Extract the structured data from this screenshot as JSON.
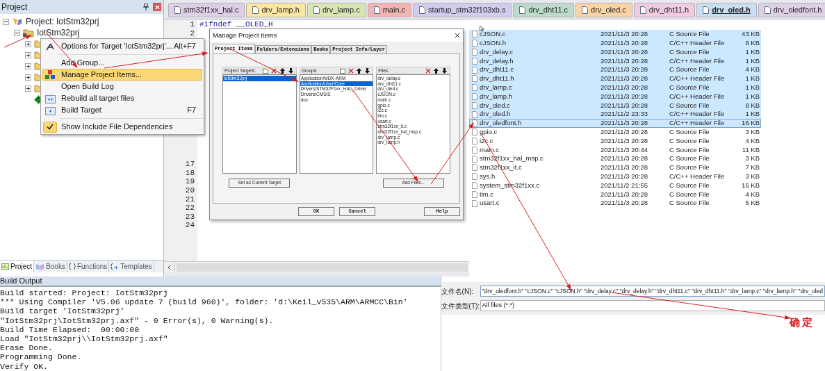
{
  "project_panel": {
    "title": "Project",
    "tree": [
      {
        "label": "Project: IotStm32prj",
        "kind": "project",
        "expanded": true,
        "children": [
          {
            "label": "IotStm32prj",
            "kind": "target",
            "expanded": true,
            "children": [
              {
                "kind": "folder",
                "expanded": false
              },
              {
                "kind": "folder",
                "expanded": false
              },
              {
                "kind": "folder",
                "expanded": false
              },
              {
                "kind": "folder",
                "expanded": false
              },
              {
                "kind": "folder",
                "expanded": false
              },
              {
                "kind": "component"
              }
            ]
          }
        ]
      }
    ],
    "bottom_tabs": [
      {
        "label": "Project",
        "selected": true
      },
      {
        "label": "Books",
        "selected": false
      },
      {
        "label": "Functions",
        "selected": false
      },
      {
        "label": "Templates",
        "selected": false
      }
    ]
  },
  "context_menu": {
    "items": [
      {
        "kind": "item",
        "label": "Options for Target 'IotStm32prj'...",
        "shortcut": "Alt+F7",
        "selected": false
      },
      {
        "kind": "separator"
      },
      {
        "kind": "item",
        "label": "Add Group...",
        "selected": false
      },
      {
        "kind": "item",
        "label": "Manage Project Items...",
        "selected": true
      },
      {
        "kind": "item",
        "label": "Open Build Log",
        "selected": false
      },
      {
        "kind": "item",
        "label": "Rebuild all target files",
        "selected": false
      },
      {
        "kind": "item",
        "label": "Build Target",
        "shortcut": "F7",
        "selected": false
      },
      {
        "kind": "separator"
      },
      {
        "kind": "check",
        "label": "Show Include File Dependencies",
        "checked": true,
        "selected": false
      }
    ]
  },
  "editor_tabs": [
    {
      "label": "stm32f1xx_hal.c",
      "color": "#dccfe6",
      "selected": false
    },
    {
      "label": "drv_lamp.h",
      "color": "#fbe7a1",
      "selected": false
    },
    {
      "label": "drv_lamp.c",
      "color": "#d9e6b4",
      "selected": false
    },
    {
      "label": "main.c",
      "color": "#f2b3b3",
      "selected": false
    },
    {
      "label": "startup_stm32f103xb.s",
      "color": "#d3ccef",
      "selected": false
    },
    {
      "label": "drv_dht11.c",
      "color": "#bcdcc9",
      "selected": false
    },
    {
      "label": "drv_oled.c",
      "color": "#fad3a6",
      "selected": false
    },
    {
      "label": "drv_dht11.h",
      "color": "#f1cbe0",
      "selected": false
    },
    {
      "label": "drv_oled.h",
      "color": "#c9def1",
      "selected": true
    },
    {
      "label": "drv_oledfont.h",
      "color": "#ddd1e6",
      "selected": false
    }
  ],
  "editor": {
    "lines": [
      {
        "number": "1",
        "code": "#ifndef __OLED_H"
      },
      {
        "number": "2"
      },
      {
        "number": "17"
      },
      {
        "number": "18"
      },
      {
        "number": "19"
      },
      {
        "number": "20"
      },
      {
        "number": "21"
      },
      {
        "number": "22"
      },
      {
        "number": "23"
      },
      {
        "number": "24"
      }
    ]
  },
  "dialog": {
    "title": "Manage Project Items",
    "tabs": [
      {
        "label": "Project Items",
        "selected": true
      },
      {
        "label": "Folders/Extensions",
        "selected": false
      },
      {
        "label": "Books",
        "selected": false
      },
      {
        "label": "Project Info/Layer",
        "selected": false
      }
    ],
    "panes": [
      {
        "label": "Project Targets:",
        "new": true,
        "items": [
          {
            "label": "IotStm32prj",
            "selected": true
          }
        ],
        "button": "Set as Current Target"
      },
      {
        "label": "Groups:",
        "new": true,
        "items": [
          {
            "label": "Application/MDK-ARM",
            "selected": false
          },
          {
            "label": "Application/User/Core",
            "selected": true
          },
          {
            "label": "Drivers/STM32F1xx_HAL_Driver",
            "selected": false
          },
          {
            "label": "Drivers/CMSIS",
            "selected": false
          },
          {
            "label": "doc",
            "selected": false
          }
        ]
      },
      {
        "label": "Files:",
        "new": false,
        "items": [
          {
            "label": "drv_delay.c",
            "selected": false
          },
          {
            "label": "drv_dht11.c",
            "selected": false
          },
          {
            "label": "drv_oled.c",
            "selected": false
          },
          {
            "label": "cJSON.c",
            "selected": false
          },
          {
            "label": "main.c",
            "selected": false
          },
          {
            "label": "gpio.c",
            "selected": false
          },
          {
            "label": "i2c.c",
            "selected": false
          },
          {
            "label": "tim.c",
            "selected": false
          },
          {
            "label": "usart.c",
            "selected": false
          },
          {
            "label": "stm32f1xx_it.c",
            "selected": false
          },
          {
            "label": "stm32f1xx_hal_msp.c",
            "selected": false
          },
          {
            "label": "drv_lamp.c",
            "selected": false
          },
          {
            "label": "drv_lamp.h",
            "selected": false
          }
        ],
        "button": "Add Files..."
      }
    ],
    "buttons": [
      "OK",
      "Cancel",
      "Help"
    ]
  },
  "file_list": [
    {
      "name": "cJSON.c",
      "date": "2021/11/3 20:28",
      "type": "C Source File",
      "size": "43 KB",
      "selected": true
    },
    {
      "name": "cJSON.h",
      "date": "2021/11/3 20:28",
      "type": "C/C++ Header File",
      "size": "8 KB",
      "selected": true
    },
    {
      "name": "drv_delay.c",
      "date": "2021/11/3 20:28",
      "type": "C Source File",
      "size": "1 KB",
      "selected": true
    },
    {
      "name": "drv_delay.h",
      "date": "2021/11/3 20:28",
      "type": "C/C++ Header File",
      "size": "1 KB",
      "selected": true
    },
    {
      "name": "drv_dht11.c",
      "date": "2021/11/3 20:28",
      "type": "C Source File",
      "size": "4 KB",
      "selected": true
    },
    {
      "name": "drv_dht11.h",
      "date": "2021/11/3 20:28",
      "type": "C/C++ Header File",
      "size": "1 KB",
      "selected": true
    },
    {
      "name": "drv_lamp.c",
      "date": "2021/11/3 20:28",
      "type": "C Source File",
      "size": "1 KB",
      "selected": true
    },
    {
      "name": "drv_lamp.h",
      "date": "2021/11/3 20:28",
      "type": "C/C++ Header File",
      "size": "1 KB",
      "selected": true
    },
    {
      "name": "drv_oled.c",
      "date": "2021/11/3 20:28",
      "type": "C Source File",
      "size": "8 KB",
      "selected": true
    },
    {
      "name": "drv_oled.h",
      "date": "2021/11/2 23:33",
      "type": "C/C++ Header File",
      "size": "1 KB",
      "selected": true
    },
    {
      "name": "drv_oledfont.h",
      "date": "2021/11/3 20:28",
      "type": "C/C++ Header File",
      "size": "16 KB",
      "selected": true,
      "focused": true
    },
    {
      "name": "gpio.c",
      "date": "2021/11/3 20:28",
      "type": "C Source File",
      "size": "3 KB",
      "selected": false
    },
    {
      "name": "i2c.c",
      "date": "2021/11/3 20:28",
      "type": "C Source File",
      "size": "4 KB",
      "selected": false
    },
    {
      "name": "main.c",
      "date": "2021/11/3 20:44",
      "type": "C Source File",
      "size": "11 KB",
      "selected": false
    },
    {
      "name": "stm32f1xx_hal_msp.c",
      "date": "2021/11/3 20:28",
      "type": "C Source File",
      "size": "3 KB",
      "selected": false
    },
    {
      "name": "stm32f1xx_it.c",
      "date": "2021/11/3 20:28",
      "type": "C Source File",
      "size": "7 KB",
      "selected": false
    },
    {
      "name": "sys.h",
      "date": "2021/11/3 20:28",
      "type": "C/C++ Header File",
      "size": "3 KB",
      "selected": false
    },
    {
      "name": "system_stm32f1xx.c",
      "date": "2021/11/2 21:55",
      "type": "C Source File",
      "size": "16 KB",
      "selected": false
    },
    {
      "name": "tim.c",
      "date": "2021/11/3 20:28",
      "type": "C Source File",
      "size": "4 KB",
      "selected": false
    },
    {
      "name": "usart.c",
      "date": "2021/11/3 20:28",
      "type": "C Source File",
      "size": "6 KB",
      "selected": false
    }
  ],
  "file_name": {
    "label": "文件名(N):",
    "value": "\"drv_oledfont.h\" \"cJSON.c\" \"cJSON.h\" \"drv_delay.c\" \"drv_delay.h\" \"drv_dht11.c\" \"drv_dht11.h\" \"drv_lamp.c\" \"drv_lamp.h\" \"drv_oled"
  },
  "file_type": {
    "label": "文件类型(T):",
    "value": "All files (*.*)"
  },
  "annotation": "确定",
  "build_output": {
    "title": "Build Output",
    "lines": [
      "Build started: Project: IotStm32prj",
      "*** Using Compiler 'V5.06 update 7 (build 960)', folder: 'd:\\Keil_v535\\ARM\\ARMCC\\Bin'",
      "Build target 'IotStm32prj'",
      "\"IotStm32prj\\IotStm32prj.axf\" - 0 Error(s), 0 Warning(s).",
      "Build Time Elapsed:  00:00:00",
      "Load \"IotStm32prj\\\\IotStm32prj.axf\"",
      "Erase Done.",
      "Programming Done.",
      "Verify OK."
    ]
  }
}
